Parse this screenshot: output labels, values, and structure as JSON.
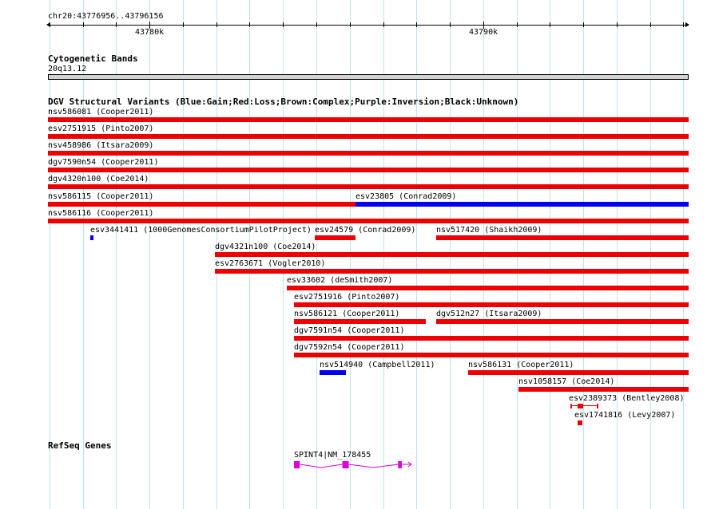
{
  "ruler": {
    "location": "chr20:43776956..43796156",
    "ticks": [
      {
        "label": "43780k",
        "pos": 43780000
      },
      {
        "label": "43790k",
        "pos": 43790000
      }
    ]
  },
  "cytoband": {
    "title": "Cytogenetic Bands",
    "band": "20q13.12"
  },
  "dgv": {
    "title": "DGV Structural Variants (Blue:Gain;Red:Loss;Brown:Complex;Purple:Inversion;Black:Unknown)",
    "colors": {
      "gain": "#0000ee",
      "loss": "#ee0000"
    },
    "features": [
      {
        "label": "nsv586081 (Cooper2011)",
        "start": 43776956,
        "end": 43796156,
        "type": "loss",
        "row": 0
      },
      {
        "label": "esv2751915 (Pinto2007)",
        "start": 43776956,
        "end": 43796156,
        "type": "loss",
        "row": 1
      },
      {
        "label": "nsv458986 (Itsara2009)",
        "start": 43776956,
        "end": 43796156,
        "type": "loss",
        "row": 2
      },
      {
        "label": "dgv7590n54 (Cooper2011)",
        "start": 43776956,
        "end": 43796156,
        "type": "loss",
        "row": 3
      },
      {
        "label": "dgv4320n100 (Coe2014)",
        "start": 43776956,
        "end": 43796156,
        "type": "loss",
        "row": 4
      },
      {
        "label": "nsv586115 (Cooper2011)",
        "start": 43776956,
        "end": 43786180,
        "type": "loss",
        "row": 5
      },
      {
        "label": "esv23805 (Conrad2009)",
        "start": 43786180,
        "end": 43796156,
        "type": "gain",
        "row": 5
      },
      {
        "label": "nsv586116 (Cooper2011)",
        "start": 43776956,
        "end": 43796156,
        "type": "loss",
        "row": 6
      },
      {
        "label": "esv3441411 (1000GenomesConsortiumPilotProject)",
        "start": 43778220,
        "end": 43778310,
        "type": "gain",
        "row": 7
      },
      {
        "label": "esv24579 (Conrad2009)",
        "start": 43784950,
        "end": 43786180,
        "type": "loss",
        "row": 7
      },
      {
        "label": "nsv517420 (Shaikh2009)",
        "start": 43788600,
        "end": 43796156,
        "type": "loss",
        "row": 7
      },
      {
        "label": "dgv4321n100 (Coe2014)",
        "start": 43781960,
        "end": 43796156,
        "type": "loss",
        "row": 8
      },
      {
        "label": "esv2763671 (Vogler2010)",
        "start": 43781960,
        "end": 43796156,
        "type": "loss",
        "row": 9
      },
      {
        "label": "esv33602 (deSmith2007)",
        "start": 43784110,
        "end": 43796156,
        "type": "loss",
        "row": 10
      },
      {
        "label": "esv2751916 (Pinto2007)",
        "start": 43784330,
        "end": 43796156,
        "type": "loss",
        "row": 11
      },
      {
        "label": "nsv586121 (Cooper2011)",
        "start": 43784330,
        "end": 43788280,
        "type": "loss",
        "row": 12
      },
      {
        "label": "dgv512n27 (Itsara2009)",
        "start": 43788600,
        "end": 43796156,
        "type": "loss",
        "row": 12
      },
      {
        "label": "dgv7591n54 (Cooper2011)",
        "start": 43784330,
        "end": 43796156,
        "type": "loss",
        "row": 13
      },
      {
        "label": "dgv7592n54 (Cooper2011)",
        "start": 43784330,
        "end": 43796156,
        "type": "loss",
        "row": 14
      },
      {
        "label": "nsv514940 (Campbell2011)",
        "start": 43785100,
        "end": 43785880,
        "type": "gain",
        "row": 15
      },
      {
        "label": "nsv586131 (Cooper2011)",
        "start": 43789560,
        "end": 43796156,
        "type": "loss",
        "row": 15
      },
      {
        "label": "nsv1058157 (Coe2014)",
        "start": 43791060,
        "end": 43796156,
        "type": "loss",
        "row": 16
      },
      {
        "label": "esv2389373 (Bentley2008)",
        "start": 43792610,
        "end": 43793450,
        "type": "loss",
        "row": 17,
        "style": "split",
        "blocks": [
          [
            43792610,
            43792650
          ],
          [
            43792840,
            43793000
          ],
          [
            43793410,
            43793450
          ]
        ]
      },
      {
        "label": "esv1741816 (Levy2007)",
        "start": 43792840,
        "end": 43792990,
        "type": "loss",
        "row": 18
      }
    ]
  },
  "refseq": {
    "title": "RefSeq Genes",
    "color": "#dd00dd",
    "genes": [
      {
        "label": "SPINT4|NM_178455",
        "start": 43784330,
        "end": 43787750,
        "strand": "+",
        "exons": [
          [
            43784330,
            43784500
          ],
          [
            43785780,
            43785970
          ],
          [
            43787450,
            43787560
          ]
        ]
      }
    ]
  }
}
